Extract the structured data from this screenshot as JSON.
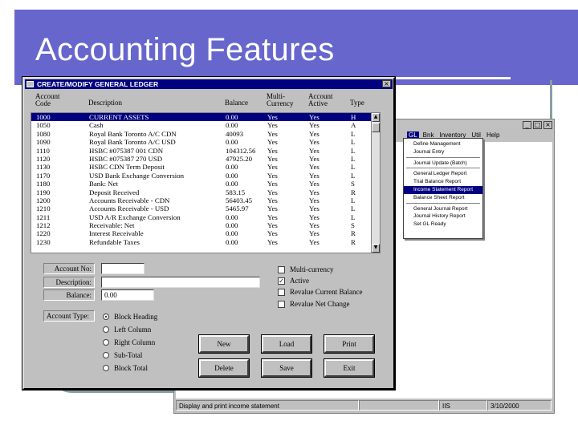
{
  "slide": {
    "title": "Accounting Features"
  },
  "background_app": {
    "menu": [
      "GL",
      "Bnk",
      "Inventory",
      "Util",
      "Help"
    ],
    "menu_active_index": 0,
    "dropdown": [
      {
        "label": "Define Management",
        "separator_after": false
      },
      {
        "label": "Journal Entry",
        "separator_after": true
      },
      {
        "label": "Journal Update (Batch)",
        "separator_after": true
      },
      {
        "label": "General Ledger Report",
        "separator_after": false
      },
      {
        "label": "Trial Balance Report",
        "separator_after": false
      },
      {
        "label": "Income Statement Report",
        "separator_after": false,
        "highlighted": true
      },
      {
        "label": "Balance Sheet Report",
        "separator_after": true
      },
      {
        "label": "General Journal Report",
        "separator_after": false
      },
      {
        "label": "Journal History Report",
        "separator_after": false
      },
      {
        "label": "Set GL Ready",
        "separator_after": false
      }
    ],
    "status": [
      "Display and print income statement",
      "",
      "IIS",
      "3/10/2000"
    ]
  },
  "dialog": {
    "title": "CREATE/MODIFY GENERAL LEDGER",
    "columns": {
      "code": "Account Code",
      "description": "Description",
      "balance": "Balance",
      "multi": "Multi-Currency",
      "active": "Account Active",
      "type": "Type"
    },
    "rows": [
      {
        "code": "1000",
        "description": "CURRENT ASSETS",
        "balance": "0.00",
        "multi": "Yes",
        "active": "Yes",
        "type": "H",
        "selected": true
      },
      {
        "code": "1050",
        "description": "Cash",
        "balance": "0.00",
        "multi": "Yes",
        "active": "Yes",
        "type": "A"
      },
      {
        "code": "1080",
        "description": "Royal Bank Toronto A/C CDN",
        "balance": "40093",
        "multi": "Yes",
        "active": "Yes",
        "type": "L"
      },
      {
        "code": "1090",
        "description": "Royal Bank Toronto A/C USD",
        "balance": "0.00",
        "multi": "Yes",
        "active": "Yes",
        "type": "L"
      },
      {
        "code": "1110",
        "description": "HSBC #075387 001 CDN",
        "balance": "104312.56",
        "multi": "Yes",
        "active": "Yes",
        "type": "L"
      },
      {
        "code": "1120",
        "description": "HSBC #075387 270 USD",
        "balance": "47925.20",
        "multi": "Yes",
        "active": "Yes",
        "type": "L"
      },
      {
        "code": "1130",
        "description": "HSBC CDN Term Deposit",
        "balance": "0.00",
        "multi": "Yes",
        "active": "Yes",
        "type": "L"
      },
      {
        "code": "1170",
        "description": "USD Bank Exchange Conversion",
        "balance": "0.00",
        "multi": "Yes",
        "active": "Yes",
        "type": "L"
      },
      {
        "code": "1180",
        "description": "Bank: Net",
        "balance": "0.00",
        "multi": "Yes",
        "active": "Yes",
        "type": "S"
      },
      {
        "code": "1190",
        "description": "Deposit Received",
        "balance": "583.15",
        "multi": "Yes",
        "active": "Yes",
        "type": "R"
      },
      {
        "code": "1200",
        "description": "Accounts Receivable - CDN",
        "balance": "56403.45",
        "multi": "Yes",
        "active": "Yes",
        "type": "L"
      },
      {
        "code": "1210",
        "description": "Accounts Receivable - USD",
        "balance": "5465.97",
        "multi": "Yes",
        "active": "Yes",
        "type": "L"
      },
      {
        "code": "1211",
        "description": "USD A/R Exchange Conversion",
        "balance": "0.00",
        "multi": "Yes",
        "active": "Yes",
        "type": "L"
      },
      {
        "code": "1212",
        "description": "Receivable: Net",
        "balance": "0.00",
        "multi": "Yes",
        "active": "Yes",
        "type": "S"
      },
      {
        "code": "1220",
        "description": "Interest Receivable",
        "balance": "0.00",
        "multi": "Yes",
        "active": "Yes",
        "type": "R"
      },
      {
        "code": "1230",
        "description": "Refundable Taxes",
        "balance": "0.00",
        "multi": "Yes",
        "active": "Yes",
        "type": "R"
      }
    ],
    "form": {
      "account_no_label": "Account No:",
      "account_no_value": "",
      "description_label": "Description:",
      "description_value": "",
      "balance_label": "Balance:",
      "balance_value": "0.00"
    },
    "checkboxes": [
      {
        "label": "Multi-currency",
        "checked": false
      },
      {
        "label": "Active",
        "checked": true
      },
      {
        "label": "Revalue Current Balance",
        "checked": false
      },
      {
        "label": "Revalue Net Change",
        "checked": false
      }
    ],
    "account_type_label": "Account Type:",
    "account_types": [
      {
        "label": "Block Heading",
        "selected": true
      },
      {
        "label": "Left Column",
        "selected": false
      },
      {
        "label": "Right Column",
        "selected": false
      },
      {
        "label": "Sub-Total",
        "selected": false
      },
      {
        "label": "Block Total",
        "selected": false
      }
    ],
    "buttons": [
      "New",
      "Load",
      "Print",
      "Delete",
      "Save",
      "Exit"
    ]
  }
}
